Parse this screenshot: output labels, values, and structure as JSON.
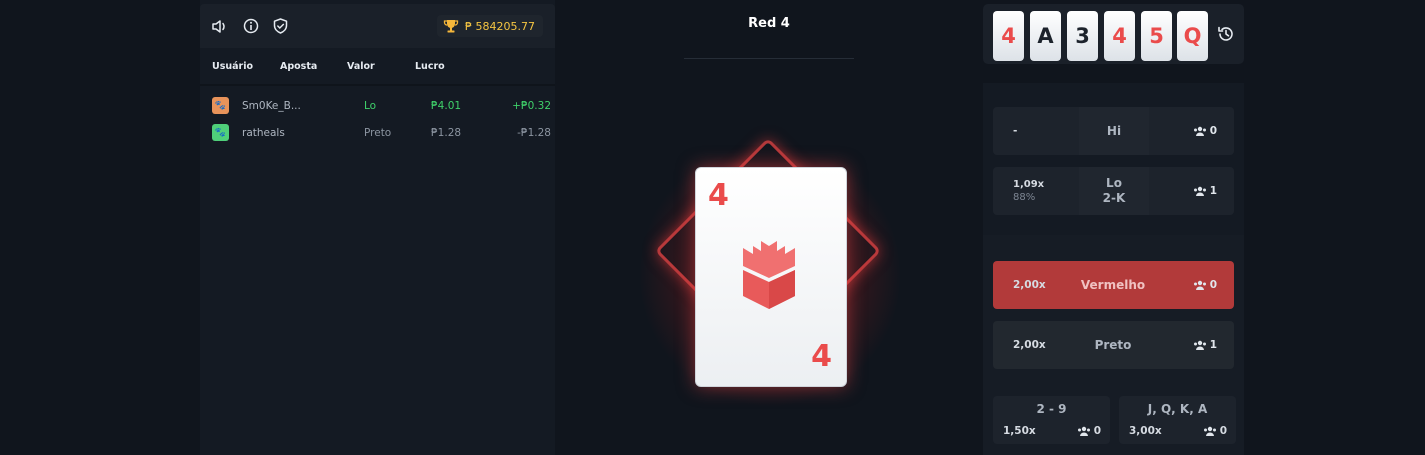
{
  "left_panel": {
    "balance": "₱ 584205.77",
    "headers": [
      "Usuário",
      "Aposta",
      "Valor",
      "Lucro"
    ],
    "rows": [
      {
        "user": "Sm0Ke_B...",
        "bet": "Lo",
        "value": "₱4.01",
        "profit": "+₱0.32",
        "avatar_color": "#e8935a"
      },
      {
        "user": "ratheals",
        "bet": "Preto",
        "value": "₱1.28",
        "profit": "-₱1.28",
        "avatar_color": "#4fcf7a"
      }
    ]
  },
  "center": {
    "title": "Red 4",
    "card": {
      "rank": "4",
      "color": "red"
    }
  },
  "history": [
    "4",
    "A",
    "3",
    "4",
    "5",
    "Q"
  ],
  "bets": {
    "hi": {
      "left": "-",
      "label": "Hi",
      "count": "0"
    },
    "lo": {
      "odds": "1,09x",
      "pct": "88%",
      "label": "Lo",
      "range": "2-K",
      "count": "1"
    },
    "vermelho": {
      "odds": "2,00x",
      "label": "Vermelho",
      "count": "0"
    },
    "preto": {
      "odds": "2,00x",
      "label": "Preto",
      "count": "1"
    },
    "range_2_9": {
      "label": "2 - 9",
      "odds": "1,50x",
      "count": "0"
    },
    "jqka": {
      "label": "J, Q, K, A",
      "odds": "3,00x",
      "count": "0"
    }
  },
  "colors": {
    "accent_red": "#ea4b4b",
    "gold": "#f5c542",
    "green": "#3fd16a"
  }
}
